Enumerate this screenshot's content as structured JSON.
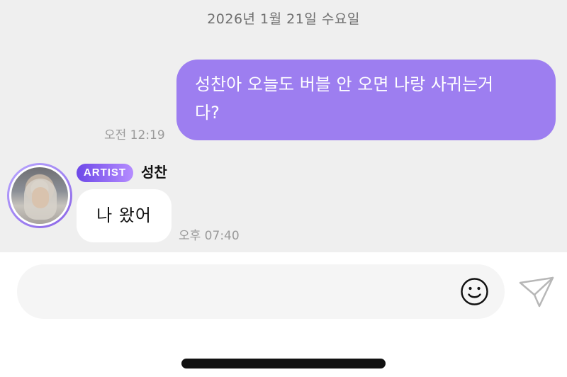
{
  "chat": {
    "date": "2026년 1월 21일 수요일",
    "outgoing_message": {
      "text": "성찬아 오늘도 버블 안 오면 나랑 사귀는거\n다?",
      "time": "오전 12:19",
      "bubble_color": "#9d7ef0"
    },
    "incoming_message": {
      "badge": "ARTIST",
      "sender": "성찬",
      "text": "나 왔어",
      "time": "오후 07:40"
    }
  },
  "composer": {
    "placeholder": "",
    "value": ""
  },
  "icons": {
    "emoji": "smiley-icon",
    "send": "paper-plane-icon"
  },
  "colors": {
    "chat_background": "#efefef",
    "artist_badge_gradient_start": "#6d48e8",
    "artist_badge_gradient_end": "#b58cff",
    "avatar_ring": "#8a63e6"
  }
}
